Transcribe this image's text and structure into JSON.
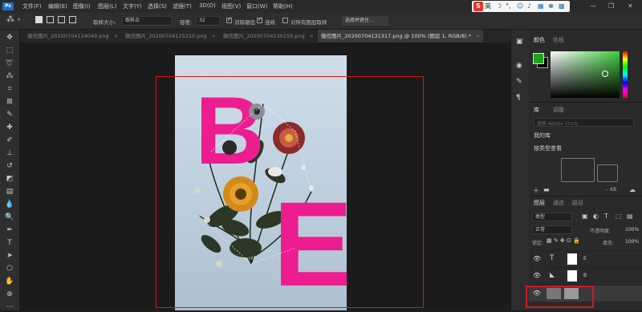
{
  "menu": [
    "文件(F)",
    "编辑(E)",
    "图像(I)",
    "图层(L)",
    "文字(Y)",
    "选择(S)",
    "滤镜(T)",
    "3D(D)",
    "视图(V)",
    "窗口(W)",
    "帮助(H)"
  ],
  "ime": {
    "logo": "S",
    "lang": "英"
  },
  "options": {
    "sample_size_label": "取样大小:",
    "sample_size_value": "取样点",
    "tolerance_label": "容差:",
    "tolerance_value": "32",
    "antialias_label": "消除锯齿",
    "contiguous_label": "连续",
    "all_layers_label": "对所有图层取样",
    "select_subject_label": "选择并遮住..."
  },
  "tabs": [
    {
      "label": "微信图片_20200704124049.png",
      "active": false
    },
    {
      "label": "微信图片_20200704125210.png",
      "active": false
    },
    {
      "label": "微信图片_20200704130159.png",
      "active": false
    },
    {
      "label": "微信图片_20200704131317.png @ 100% (图层 1, RGB/8) *",
      "active": true
    }
  ],
  "color_panel": {
    "title": "颜色",
    "tab2": "色板",
    "fg_color": "#1aa61a"
  },
  "lib_panel": {
    "title": "库",
    "tab2": "调整",
    "search_placeholder": "搜索 Adobe Stock",
    "library": "我的库",
    "view": "按类型查看",
    "size": "-- KB"
  },
  "layers_panel": {
    "title": "图层",
    "tab2": "通道",
    "tab3": "路径",
    "kind": "类型",
    "mode": "正常",
    "opacity_label": "不透明度:",
    "opacity": "100%",
    "lock_label": "锁定:",
    "fill_label": "填充:",
    "fill": "100%",
    "layers": [
      {
        "name": "E",
        "type": "text"
      },
      {
        "name": "B",
        "type": "text"
      },
      {
        "name": "",
        "type": "image"
      }
    ]
  },
  "artwork": {
    "letter1": "B",
    "letter2": "E",
    "letter_color": "#ec1e8f"
  }
}
